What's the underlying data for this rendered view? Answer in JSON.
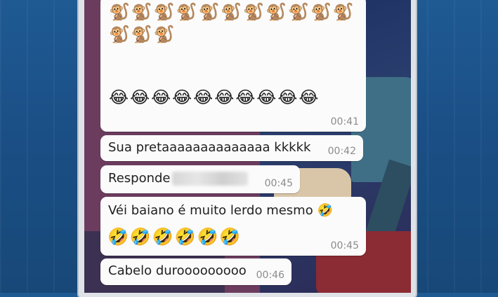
{
  "chat": {
    "messages": [
      {
        "id": "emoji-message",
        "emoji_rows": [
          "🐒🐒🐒🐒🐒🐒🐒🐒🐒🐒🐒",
          "🐒🐒🐒",
          "😂😂😂😂😂😂😂😂😂😂"
        ],
        "time": "00:41"
      },
      {
        "id": "msg-2",
        "text": "Sua pretaaaaaaaaaaaaaa kkkkk",
        "time": "00:42"
      },
      {
        "id": "msg-3",
        "text": "Responde",
        "redacted": true,
        "time": "00:45"
      },
      {
        "id": "msg-4",
        "text": "Véi baiano é muito lerdo mesmo 🤣",
        "emoji_line": "🤣🤣🤣🤣🤣🤣",
        "time": "00:45"
      },
      {
        "id": "msg-5",
        "text": "Cabelo durooooooooo",
        "time": "00:46"
      }
    ]
  },
  "colors": {
    "bubble": "#fbfbfb",
    "time": "#8b8b8b",
    "studio_bg": "#1f5a93"
  }
}
